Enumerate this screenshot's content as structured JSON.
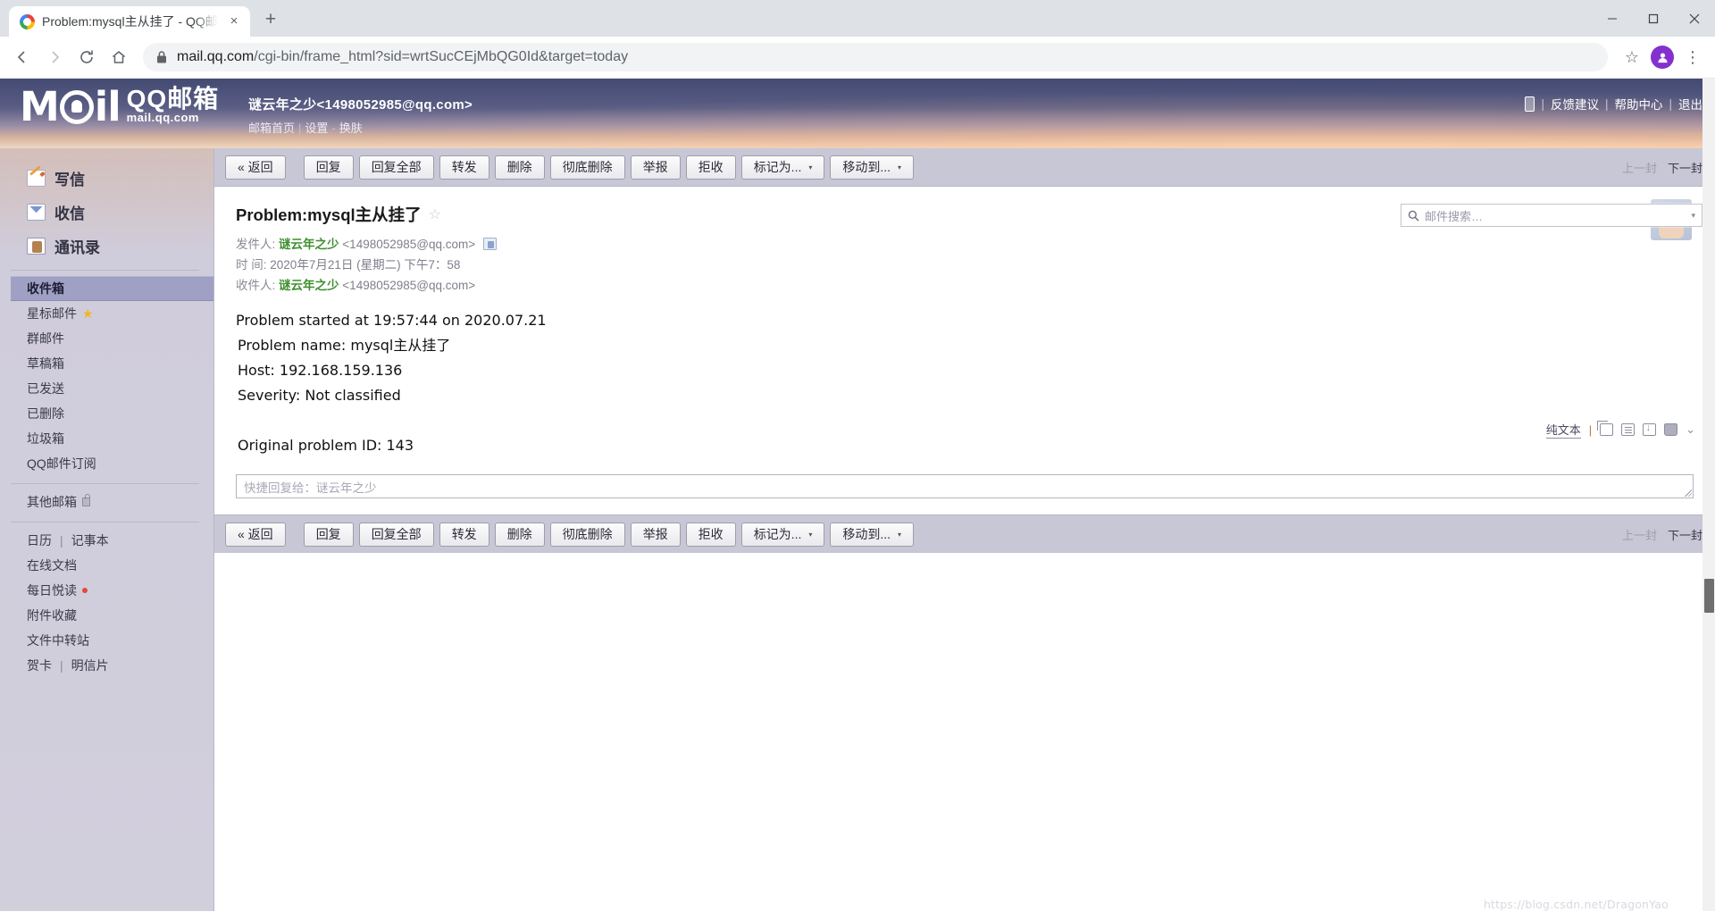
{
  "browser": {
    "tab": {
      "title": "Problem:mysql主从挂了 - QQ邮箱",
      "favicon": "qq-mail-favicon",
      "close": "×"
    },
    "new_tab": "+",
    "window_controls": {
      "minimize": "minimize-icon",
      "maximize": "maximize-icon",
      "close": "close-icon"
    },
    "nav": {
      "back": "←",
      "forward": "→",
      "reload": "⟳",
      "home": "⌂"
    },
    "omnibox": {
      "lock": "lock-icon",
      "url_domain": "mail.qq.com",
      "url_path": "/cgi-bin/frame_html?sid=wrtSucCEjMbQG0Id&target=today",
      "bookmark": "☆"
    },
    "profile_initial": "",
    "menu": "⋮"
  },
  "header": {
    "logo_text_main": "QQ邮箱",
    "logo_text_sub": "mail.qq.com",
    "logo_mark_left": "M",
    "logo_mark_right": "il",
    "account": "谜云年之少<1498052985@qq.com>",
    "links": [
      {
        "label": "邮箱首页"
      },
      {
        "label": "设置"
      },
      {
        "label": "换肤"
      }
    ],
    "right_links": [
      {
        "label": "反馈建议"
      },
      {
        "label": "帮助中心"
      },
      {
        "label": "退出"
      }
    ],
    "phone_icon": "mobile-phone-icon"
  },
  "search": {
    "placeholder": "邮件搜索…",
    "icon": "search-icon",
    "caret": "▾"
  },
  "sidebar": {
    "main": [
      {
        "label": "写信",
        "icon": "compose-icon"
      },
      {
        "label": "收信",
        "icon": "receive-mail-icon"
      },
      {
        "label": "通讯录",
        "icon": "contacts-icon"
      }
    ],
    "folders": [
      {
        "label": "收件箱",
        "selected": true
      },
      {
        "label": "星标邮件",
        "star": "★"
      },
      {
        "label": "群邮件"
      },
      {
        "label": "草稿箱"
      },
      {
        "label": "已发送"
      },
      {
        "label": "已删除"
      },
      {
        "label": "垃圾箱"
      },
      {
        "label": "QQ邮件订阅"
      }
    ],
    "other": {
      "label": "其他邮箱",
      "lock": "lock-icon"
    },
    "tools": [
      {
        "label": "日历",
        "pipe": "|",
        "label2": "记事本"
      },
      {
        "label": "在线文档"
      },
      {
        "label": "每日悦读",
        "dot": true
      },
      {
        "label": "附件收藏"
      },
      {
        "label": "文件中转站"
      },
      {
        "label": "贺卡",
        "pipe": "|",
        "label2": "明信片"
      }
    ]
  },
  "toolbar": {
    "back": "« 返回",
    "buttons": [
      {
        "label": "回复"
      },
      {
        "label": "回复全部"
      },
      {
        "label": "转发"
      },
      {
        "label": "删除"
      },
      {
        "label": "彻底删除"
      },
      {
        "label": "举报"
      },
      {
        "label": "拒收"
      },
      {
        "label": "标记为...",
        "caret": "▾"
      },
      {
        "label": "移动到...",
        "caret": "▾"
      }
    ],
    "prev": "上一封",
    "next": "下一封"
  },
  "mail": {
    "subject": "Problem:mysql主从挂了",
    "star": "☆",
    "from_label": "发件人:",
    "from_name": "谜云年之少",
    "from_addr": "<1498052985@qq.com>",
    "time_label": "时  间:",
    "time_value": "2020年7月21日 (星期二) 下午7：58",
    "to_label": "收件人:",
    "to_name": "谜云年之少",
    "to_addr": "<1498052985@qq.com>",
    "view_mode": "纯文本",
    "view_icons": [
      "new-window-icon",
      "list-view-icon",
      "archive-icon",
      "print-icon",
      "expand-chevron-icon"
    ],
    "body": [
      "Problem started at 19:57:44 on 2020.07.21",
      " Problem name: mysql主从挂了",
      " Host: 192.168.159.136",
      " Severity: Not classified",
      "",
      " Original problem ID: 143"
    ]
  },
  "reply": {
    "placeholder": "快捷回复给：谜云年之少"
  },
  "watermark": "https://blog.csdn.net/DragonYao"
}
